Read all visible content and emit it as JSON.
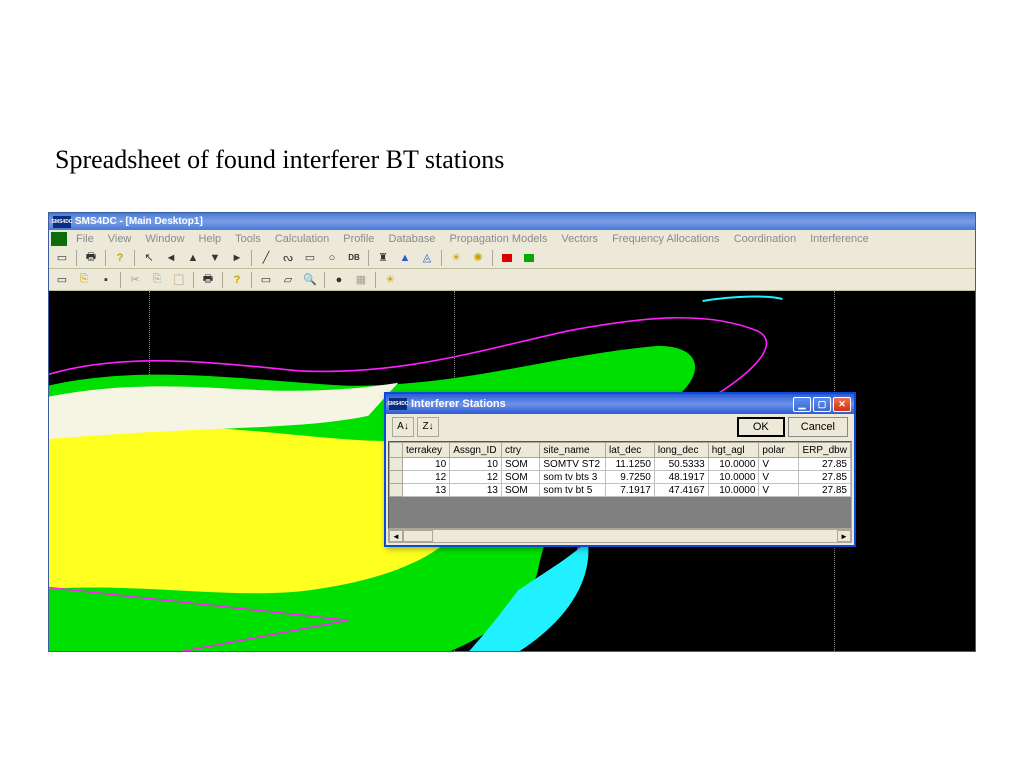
{
  "slide": {
    "title": "Spreadsheet of found interferer BT stations"
  },
  "app": {
    "title": "SMS4DC - [Main Desktop1]",
    "logo_text": "SMS4DC",
    "menu": [
      "File",
      "View",
      "Window",
      "Help",
      "Tools",
      "Calculation",
      "Profile",
      "Database",
      "Propagation Models",
      "Vectors",
      "Frequency Allocations",
      "Coordination",
      "Interference"
    ]
  },
  "dialog": {
    "title": "Interferer Stations",
    "logo_text": "SMS4DC",
    "ok": "OK",
    "cancel": "Cancel",
    "columns": [
      "",
      "terrakey",
      "Assgn_ID",
      "ctry",
      "site_name",
      "lat_dec",
      "long_dec",
      "hgt_agl",
      "polar",
      "ERP_dbw"
    ],
    "rows": [
      {
        "terrakey": "10",
        "assgn_id": "10",
        "ctry": "SOM",
        "site_name": "SOMTV ST2",
        "lat_dec": "11.1250",
        "long_dec": "50.5333",
        "hgt_agl": "10.0000",
        "polar": "V",
        "erp_dbw": "27.85"
      },
      {
        "terrakey": "12",
        "assgn_id": "12",
        "ctry": "SOM",
        "site_name": "som tv bts 3",
        "lat_dec": "9.7250",
        "long_dec": "48.1917",
        "hgt_agl": "10.0000",
        "polar": "V",
        "erp_dbw": "27.85"
      },
      {
        "terrakey": "13",
        "assgn_id": "13",
        "ctry": "SOM",
        "site_name": "som tv bt 5",
        "lat_dec": "7.1917",
        "long_dec": "47.4167",
        "hgt_agl": "10.0000",
        "polar": "V",
        "erp_dbw": "27.85"
      }
    ]
  }
}
